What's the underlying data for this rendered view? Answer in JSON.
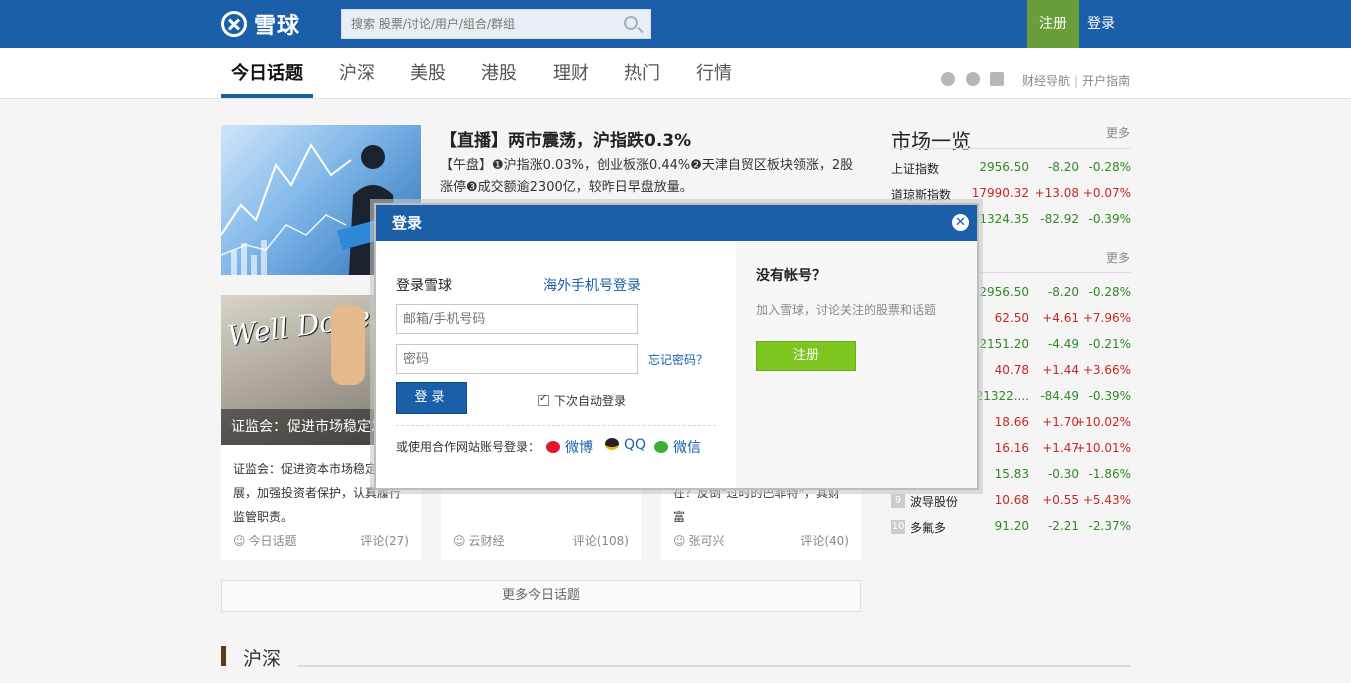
{
  "header": {
    "logo_text": "雪球",
    "search_placeholder": "搜索 股票/讨论/用户/组合/群组",
    "register_label": "注册",
    "login_label": "登录"
  },
  "nav": {
    "tabs": [
      "今日话题",
      "沪深",
      "美股",
      "港股",
      "理财",
      "热门",
      "行情"
    ],
    "active_tab": "今日话题",
    "links": [
      "财经导航",
      "开户指南"
    ]
  },
  "feature": {
    "title": "【直播】两市震荡，沪指跌0.3%",
    "summary": "【午盘】❶沪指涨0.03%，创业板涨0.44%❷天津自贸区板块领涨，2股涨停❸成交额逾2300亿，较昨日早盘放量。"
  },
  "cards": [
    {
      "image_caption": "证监会：促进市场稳定发展",
      "image_text": "Well Done!",
      "text": "证监会：促进资本市场稳定发展，加强投资者保护，认真履行监管职责。",
      "author": "今日话题",
      "comments": "评论(27)"
    },
    {
      "image_caption": "",
      "text": "",
      "author": "云财经",
      "comments": "评论(108)"
    },
    {
      "image_caption": "",
      "text": "在？反倒\"过时的巴菲特\"，其财富",
      "author": "张可兴",
      "comments": "评论(40)"
    }
  ],
  "more_topics_label": "更多今日话题",
  "section": {
    "title": "沪深"
  },
  "market": {
    "title": "市场一览",
    "more_label": "更多",
    "indices": [
      {
        "name": "上证指数",
        "price": "2956.50",
        "change": "-8.20",
        "percent": "-0.28%",
        "direction": "down"
      },
      {
        "name": "道琼斯指数",
        "price": "17990.32",
        "change": "+13.08",
        "percent": "+0.07%",
        "direction": "up"
      },
      {
        "name": "",
        "price": "21324.35",
        "change": "-82.92",
        "percent": "-0.39%",
        "direction": "down"
      }
    ],
    "stocks": [
      {
        "rank": "",
        "name": "",
        "price": "2956.50",
        "change": "-8.20",
        "percent": "-0.28%",
        "direction": "down"
      },
      {
        "rank": "",
        "name": "",
        "price": "62.50",
        "change": "+4.61",
        "percent": "+7.96%",
        "direction": "up"
      },
      {
        "rank": "",
        "name": "",
        "price": "2151.20",
        "change": "-4.49",
        "percent": "-0.21%",
        "direction": "down"
      },
      {
        "rank": "",
        "name": "",
        "price": "40.78",
        "change": "+1.44",
        "percent": "+3.66%",
        "direction": "up"
      },
      {
        "rank": "",
        "name": "",
        "price": "21322....",
        "change": "-84.49",
        "percent": "-0.39%",
        "direction": "down"
      },
      {
        "rank": "",
        "name": "",
        "price": "18.66",
        "change": "+1.70",
        "percent": "+10.02%",
        "direction": "up"
      },
      {
        "rank": "",
        "name": "",
        "price": "16.16",
        "change": "+1.47",
        "percent": "+10.01%",
        "direction": "up"
      },
      {
        "rank": "",
        "name": "",
        "price": "15.83",
        "change": "-0.30",
        "percent": "-1.86%",
        "direction": "down"
      },
      {
        "rank": "9",
        "name": "波导股份",
        "price": "10.68",
        "change": "+0.55",
        "percent": "+5.43%",
        "direction": "up"
      },
      {
        "rank": "10",
        "name": "多氟多",
        "price": "91.20",
        "change": "-2.21",
        "percent": "-2.37%",
        "direction": "down"
      }
    ]
  },
  "modal": {
    "title": "登录",
    "login_heading": "登录雪球",
    "overseas_link": "海外手机号登录",
    "email_placeholder": "邮箱/手机号码",
    "password_placeholder": "密码",
    "forgot_label": "忘记密码？",
    "submit_label": "登录",
    "remember_label": "下次自动登录",
    "partner_prompt": "或使用合作网站账号登录：",
    "partners": [
      "微博",
      "QQ",
      "微信"
    ],
    "no_account": "没有帐号？",
    "join_text": "加入雪球，讨论关注的股票和话题",
    "register_label": "注册"
  }
}
